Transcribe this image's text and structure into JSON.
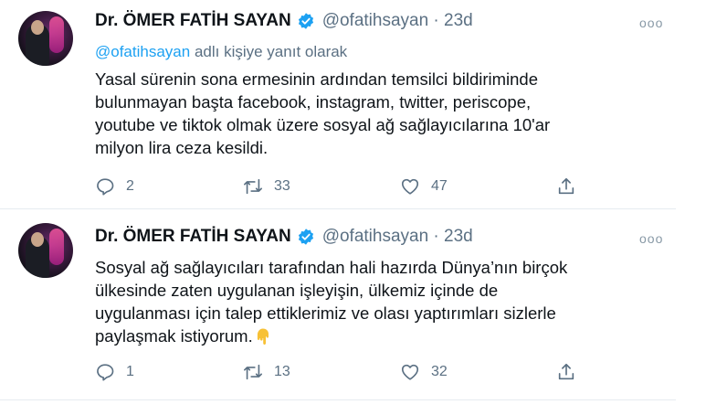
{
  "tweets": [
    {
      "author_name": "Dr. ÖMER FATİH SAYAN",
      "handle_time": "@ofatihsayan · 23d",
      "reply_to_handle": "@ofatihsayan",
      "reply_to_suffix": " adlı kişiye yanıt olarak",
      "text_lines": [
        "Yasal sürenin sona ermesinin ardından temsilci bildiriminde",
        "bulunmayan başta facebook, instagram, twitter, periscope,",
        "youtube ve tiktok olmak üzere sosyal ağ sağlayıcılarına 10'ar",
        "milyon lira ceza kesildi."
      ],
      "replies": "2",
      "retweets": "33",
      "likes": "47",
      "more": "ooo"
    },
    {
      "author_name": "Dr. ÖMER FATİH SAYAN",
      "handle_time": "@ofatihsayan · 23d",
      "text_lines": [
        "Sosyal ağ sağlayıcıları tarafından hali hazırda Dünya’nın birçok",
        "ülkesinde zaten uygulanan işleyişin, ülkemiz içinde de",
        "uygulanması için talep ettiklerimiz ve olası yaptırımları sizlerle",
        "paylaşmak istiyorum."
      ],
      "replies": "1",
      "retweets": "13",
      "likes": "32",
      "more": "ooo"
    }
  ],
  "icons": {
    "verified": "verified-badge-icon",
    "reply": "reply-icon",
    "retweet": "retweet-icon",
    "like": "heart-icon",
    "share": "share-icon",
    "emoji": "pointing-down-hand-emoji"
  },
  "colors": {
    "link": "#1da1f2",
    "secondary_text": "#5b7083",
    "verified": "#1da1f2"
  }
}
